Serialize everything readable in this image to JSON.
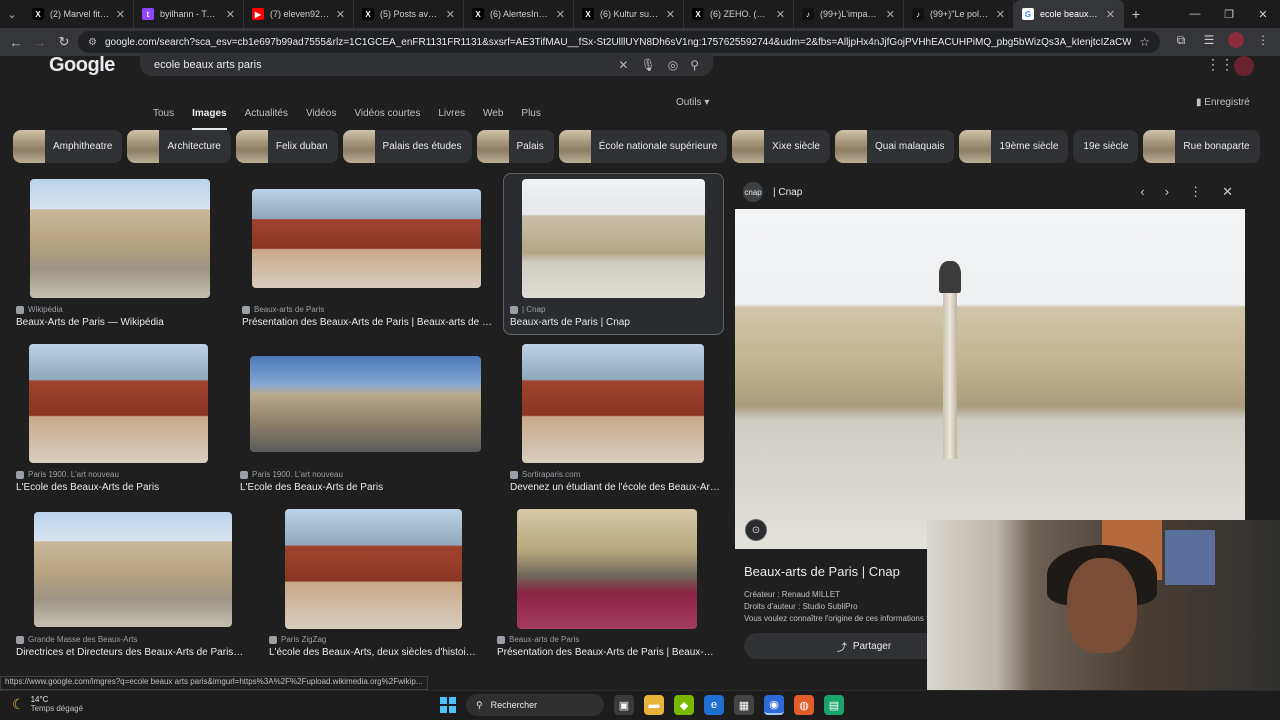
{
  "tabs": [
    {
      "icon": "x-icon",
      "fav_color": "#000000",
      "fav_glyph": "X",
      "title": "(2) Marvel fitness"
    },
    {
      "icon": "twitch-icon",
      "fav_color": "#9146ff",
      "fav_glyph": "t",
      "title": "byilhann - Twitch"
    },
    {
      "icon": "youtube-icon",
      "fav_color": "#ff0000",
      "fav_glyph": "▶",
      "title": "(7) eleven92i - Yo"
    },
    {
      "icon": "x-icon",
      "fav_color": "#000000",
      "fav_glyph": "X",
      "title": "(5) Posts avec rép"
    },
    {
      "icon": "x-icon",
      "fav_color": "#000000",
      "fav_glyph": "X",
      "title": "(6) AlertesInfos (@"
    },
    {
      "icon": "x-icon",
      "fav_color": "#000000",
      "fav_glyph": "X",
      "title": "(6) Kultur sur X : \""
    },
    {
      "icon": "x-icon",
      "fav_color": "#000000",
      "fav_glyph": "X",
      "title": "(6) ZEHO. (J'ai sau"
    },
    {
      "icon": "tiktok-icon",
      "fav_color": "#111111",
      "fav_glyph": "♪",
      "title": "(99+)L'impact de"
    },
    {
      "icon": "tiktok-icon",
      "fav_color": "#111111",
      "fav_glyph": "♪",
      "title": "(99+)\"Le policier"
    },
    {
      "icon": "google-icon",
      "fav_color": "#ffffff",
      "fav_glyph": "G",
      "title": "ecole beaux arts p",
      "active": true
    }
  ],
  "address": {
    "url": "google.com/search?sca_esv=cb1e697b99ad7555&rlz=1C1GCEA_enFR1131FR1131&sxsrf=AE3TifMAU__fSx-St2UlllUYN8Dh6sV1ng:1757625592744&udm=2&fbs=AlljpHx4nJjfGojPVHhEACUHPiMQ_pbg5bWizQs3A_kIenjtcIZaCWQ2YVOWcnHYc_MHE3..."
  },
  "google": {
    "logo": "Google",
    "query": "ecole beaux arts paris",
    "nav": [
      "Tous",
      "Images",
      "Actualités",
      "Vidéos",
      "Vidéos courtes",
      "Livres",
      "Web",
      "Plus"
    ],
    "nav_active": "Images",
    "outils": "Outils",
    "saved": "Enregistré"
  },
  "chips": [
    {
      "label": "Amphitheatre",
      "img": true
    },
    {
      "label": "Architecture",
      "img": true
    },
    {
      "label": "Felix duban",
      "img": true
    },
    {
      "label": "Palais des études",
      "img": true
    },
    {
      "label": "Palais",
      "img": true
    },
    {
      "label": "École nationale supérieure",
      "img": true
    },
    {
      "label": "Xixe siècle",
      "img": true
    },
    {
      "label": "Quai malaquais",
      "img": true
    },
    {
      "label": "19ème siècle",
      "img": true
    },
    {
      "label": "19e siècle",
      "img": false
    },
    {
      "label": "Rue bonaparte",
      "img": true
    }
  ],
  "results": [
    {
      "source": "Wikipédia",
      "title": "Beaux-Arts de Paris — Wikipédia",
      "style": "facade"
    },
    {
      "source": "Beaux-arts de Paris",
      "title": "Présentation des Beaux-Arts de Paris | Beaux-arts de P...",
      "style": "hall"
    },
    {
      "source": "| Cnap",
      "title": "Beaux-arts de Paris | Cnap",
      "style": "court",
      "selected": true
    },
    {
      "source": "Paris 1900. L'art nouveau",
      "title": "L'Ecole des Beaux-Arts de Paris",
      "style": "hall"
    },
    {
      "source": "Paris 1900. L'art nouveau",
      "title": "L'Ecole des Beaux-Arts de Paris",
      "style": "street"
    },
    {
      "source": "Sortiraparis.com",
      "title": "Devenez un étudiant de l'école des Beaux-Art...",
      "style": "hall"
    },
    {
      "source": "Grande Masse des Beaux-Arts",
      "title": "Directrices et Directeurs des Beaux-Arts de Paris - ...",
      "style": "facade"
    },
    {
      "source": "Paris ZigZag",
      "title": "L'école des Beaux-Arts, deux siècles d'histoire ...",
      "style": "hall"
    },
    {
      "source": "Beaux-arts de Paris",
      "title": "Présentation des Beaux-Arts de Paris | Beaux-art...",
      "style": "chapel"
    }
  ],
  "preview": {
    "logo": "cnap",
    "site": "| Cnap",
    "title": "Beaux-arts de Paris | Cnap",
    "creator": "Créateur : Renaud MILLET",
    "rights": "Droits d'auteur : Studio SubliPro",
    "origin": "Vous voulez connaître l'origine de ces informations ?",
    "share": "Partager"
  },
  "status_url": "https://www.google.com/imgres?q=ecole beaux arts paris&imgurl=https%3A%2F%2Fupload.wikimedia.org%2Fwikip...",
  "taskbar": {
    "temp": "14°C",
    "weather": "Temps dégagé",
    "search": "Rechercher"
  }
}
